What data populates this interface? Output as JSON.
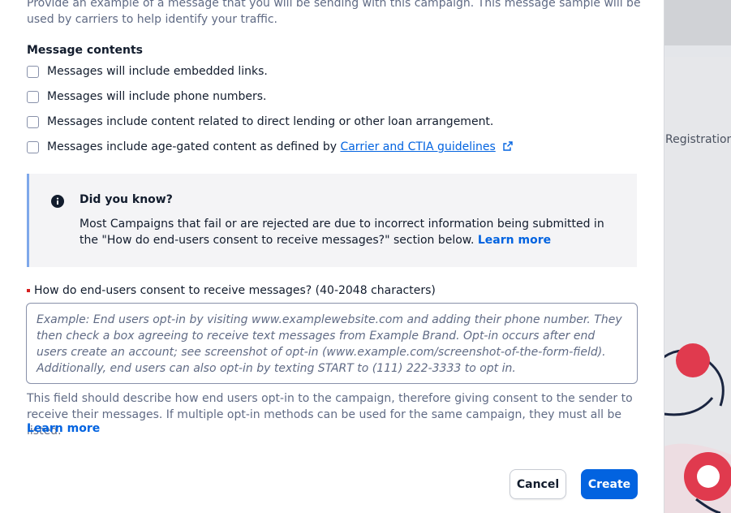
{
  "background": {
    "label": "Registration"
  },
  "modal": {
    "intro_text": "Provide an example of a message that you will be sending with this campaign. This message sample will be used by carriers to help identify your traffic.",
    "message_contents_label": "Message contents",
    "checkboxes": [
      {
        "label": "Messages will include embedded links.",
        "checked": false
      },
      {
        "label": "Messages will include phone numbers.",
        "checked": false
      },
      {
        "label": "Messages include content related to direct lending or other loan arrangement.",
        "checked": false
      },
      {
        "label_prefix": "Messages include age-gated content as defined by ",
        "link": "Carrier and CTIA guidelines",
        "checked": false
      }
    ],
    "callout": {
      "title": "Did you know?",
      "body": "Most Campaigns that fail or are rejected are due to incorrect information being submitted in the \"How do end-users consent to receive messages?\" section below.",
      "link": "Learn more"
    },
    "consent_field": {
      "label": "How do end-users consent to receive messages? (40-2048 characters)",
      "placeholder": "Example: End users opt-in by visiting www.examplewebsite.com and adding their phone number. They then check a box agreeing to receive text messages from Example Brand. Opt-in occurs after end users create an account; see screenshot of opt-in (www.example.com/screenshot-of-the-form-field). Additionally, end users can also opt-in by texting START to (111) 222-3333 to opt in.",
      "value": "",
      "help_text": "This field should describe how end users opt-in to the campaign, therefore giving consent to the sender to receive their messages. If multiple opt-in methods can be used for the same campaign, they must all be listed.",
      "help_link": "Learn more"
    },
    "buttons": {
      "cancel": "Cancel",
      "create": "Create"
    }
  },
  "colors": {
    "primary": "#0263e0",
    "required": "#d61f1f",
    "callout_border": "#7ea8ea"
  }
}
